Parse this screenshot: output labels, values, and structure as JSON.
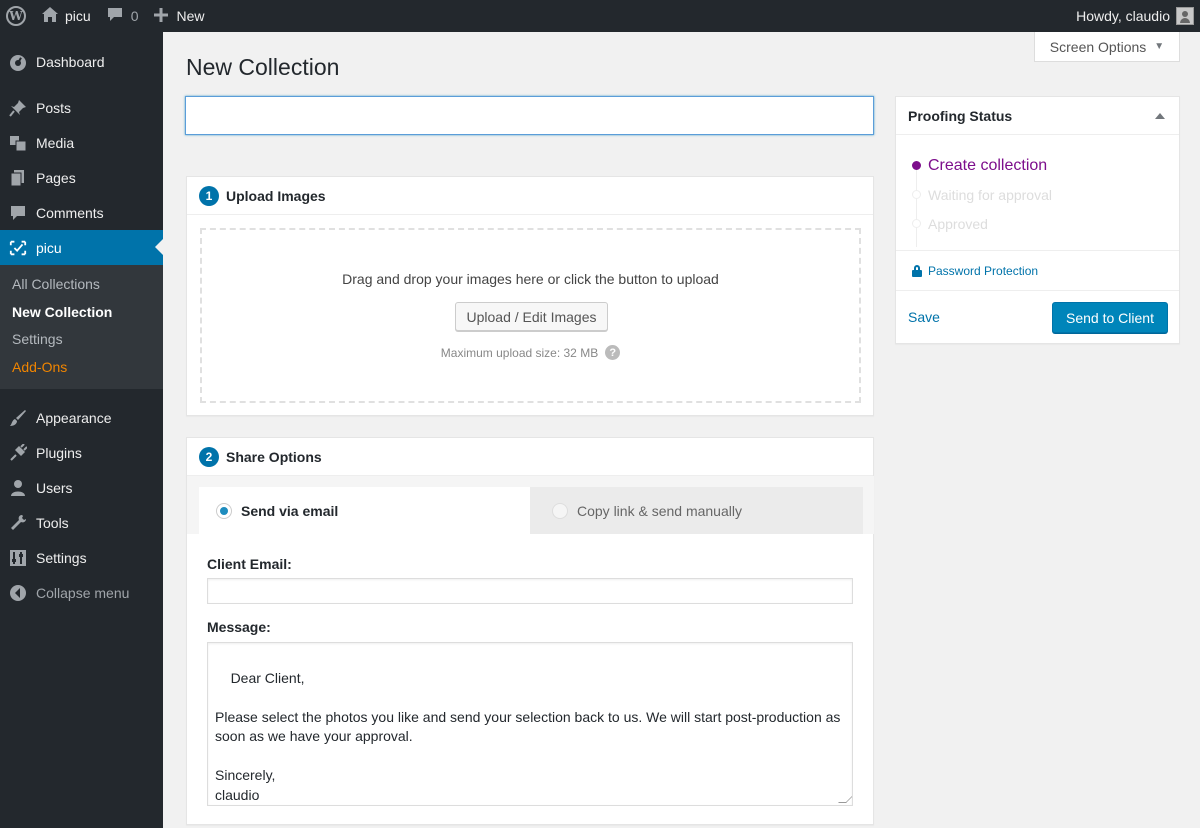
{
  "adminbar": {
    "site_name": "picu",
    "comments_count": "0",
    "new_label": "New",
    "greeting": "Howdy, claudio"
  },
  "sidebar": {
    "items_top": [
      {
        "label": "Dashboard",
        "icon": "dashboard-icon"
      }
    ],
    "items_mid": [
      {
        "label": "Posts",
        "icon": "pushpin-icon"
      },
      {
        "label": "Media",
        "icon": "media-icon"
      },
      {
        "label": "Pages",
        "icon": "pages-icon"
      },
      {
        "label": "Comments",
        "icon": "comment-icon"
      }
    ],
    "current": {
      "label": "picu",
      "icon": "picu-icon"
    },
    "submenu": [
      "All Collections",
      "New Collection",
      "Settings",
      "Add-Ons"
    ],
    "items_bottom": [
      {
        "label": "Appearance",
        "icon": "brush-icon"
      },
      {
        "label": "Plugins",
        "icon": "plugin-icon"
      },
      {
        "label": "Users",
        "icon": "user-icon"
      },
      {
        "label": "Tools",
        "icon": "wrench-icon"
      },
      {
        "label": "Settings",
        "icon": "settings-icon"
      }
    ],
    "collapse_label": "Collapse menu"
  },
  "screen_options": "Screen Options",
  "page_title": "New Collection",
  "title_input": {
    "value": ""
  },
  "upload": {
    "step": "1",
    "heading": "Upload Images",
    "dropzone_text": "Drag and drop your images here or click the button to upload",
    "button_label": "Upload / Edit Images",
    "max_size": "Maximum upload size: 32 MB"
  },
  "share": {
    "step": "2",
    "heading": "Share Options",
    "tab_email": "Send via email",
    "tab_manual": "Copy link & send manually",
    "email_label": "Client Email:",
    "email_value": "",
    "message_label": "Message:",
    "message_value": "Dear Client,\n\nPlease select the photos you like and send your selection back to us. We will start post-production as soon as we have your approval.\n\nSincerely,\nclaudio"
  },
  "proofing": {
    "heading": "Proofing Status",
    "statuses": [
      "Create collection",
      "Waiting for approval",
      "Approved"
    ],
    "password_protection": "Password Protection",
    "save_label": "Save",
    "send_label": "Send to Client"
  },
  "colors": {
    "admin_dark": "#23282d",
    "accent_blue": "#0073aa",
    "status_purple": "#7d0e8c",
    "addons_orange": "#f18500"
  }
}
